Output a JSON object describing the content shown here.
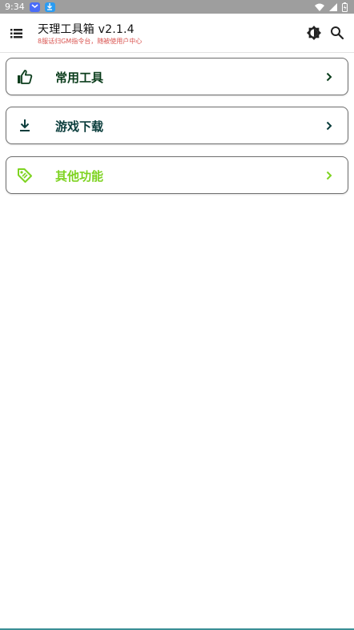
{
  "status_bar": {
    "time": "9:34"
  },
  "header": {
    "title": "天理工具箱 v2.1.4",
    "subtitle": "8服话归GM指令台，随被使用户中心"
  },
  "cards": [
    {
      "label": "常用工具",
      "icon": "thumb-up-icon",
      "color": "#0b3d1c"
    },
    {
      "label": "游戏下载",
      "icon": "download-icon",
      "color": "#0b3d3c"
    },
    {
      "label": "其他功能",
      "icon": "tag-icon",
      "color": "#7ed321"
    }
  ],
  "colors": {
    "status_bar_bg": "#9e9e9e",
    "subtitle": "#d9534f",
    "bottom_accent": "#3a8f95"
  }
}
